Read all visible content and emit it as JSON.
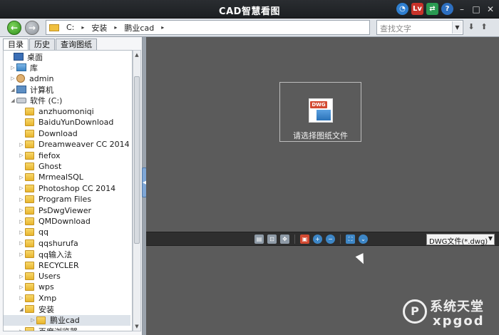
{
  "window": {
    "title": "CAD智慧看图"
  },
  "titlebar_icons": [
    {
      "name": "gauge-icon",
      "color": "#2f7fd0"
    },
    {
      "name": "pdf-icon",
      "text": "Lv",
      "color": "#c8332a"
    },
    {
      "name": "share-icon",
      "color": "#2a9a52"
    },
    {
      "name": "help-icon",
      "text": "?",
      "color": "#2d6fc0"
    }
  ],
  "window_controls": {
    "minimize": "–",
    "maximize": "□",
    "close": "✕"
  },
  "address": {
    "segments": [
      "C:",
      "安装",
      "鹏业cad"
    ],
    "separator": "▸",
    "search_placeholder": "查找文字"
  },
  "tabs": [
    {
      "label": "目录",
      "active": true
    },
    {
      "label": "历史",
      "active": false
    },
    {
      "label": "查询图纸",
      "active": false
    }
  ],
  "tree": [
    {
      "label": "桌面",
      "level": 0,
      "icon": "desktop",
      "expand": ""
    },
    {
      "label": "库",
      "level": 1,
      "icon": "library",
      "expand": "▷"
    },
    {
      "label": "admin",
      "level": 1,
      "icon": "user",
      "expand": "▷"
    },
    {
      "label": "计算机",
      "level": 1,
      "icon": "computer",
      "expand": "◢"
    },
    {
      "label": "软件 (C:)",
      "level": 2,
      "icon": "drive",
      "expand": "◢"
    },
    {
      "label": "anzhuomoniqi",
      "level": 3,
      "icon": "folder",
      "expand": ""
    },
    {
      "label": "BaiduYunDownload",
      "level": 3,
      "icon": "folder",
      "expand": ""
    },
    {
      "label": "Download",
      "level": 3,
      "icon": "folder",
      "expand": ""
    },
    {
      "label": "Dreamweaver CC 2014",
      "level": 3,
      "icon": "folder",
      "expand": "▷"
    },
    {
      "label": "fiefox",
      "level": 3,
      "icon": "folder",
      "expand": "▷"
    },
    {
      "label": "Ghost",
      "level": 3,
      "icon": "folder",
      "expand": ""
    },
    {
      "label": "MrmealSQL",
      "level": 3,
      "icon": "folder",
      "expand": "▷"
    },
    {
      "label": "Photoshop CC 2014",
      "level": 3,
      "icon": "folder",
      "expand": "▷"
    },
    {
      "label": "Program Files",
      "level": 3,
      "icon": "folder",
      "expand": "▷"
    },
    {
      "label": "PsDwgViewer",
      "level": 3,
      "icon": "folder",
      "expand": "▷"
    },
    {
      "label": "QMDownload",
      "level": 3,
      "icon": "folder",
      "expand": "▷"
    },
    {
      "label": "qq",
      "level": 3,
      "icon": "folder",
      "expand": "▷"
    },
    {
      "label": "qqshurufa",
      "level": 3,
      "icon": "folder",
      "expand": "▷"
    },
    {
      "label": "qq输入法",
      "level": 3,
      "icon": "folder",
      "expand": "▷"
    },
    {
      "label": "RECYCLER",
      "level": 3,
      "icon": "folder",
      "expand": ""
    },
    {
      "label": "Users",
      "level": 3,
      "icon": "folder",
      "expand": "▷"
    },
    {
      "label": "wps",
      "level": 3,
      "icon": "folder",
      "expand": "▷"
    },
    {
      "label": "Xmp",
      "level": 3,
      "icon": "folder",
      "expand": "▷"
    },
    {
      "label": "安装",
      "level": 3,
      "icon": "folder",
      "expand": "◢"
    },
    {
      "label": "鹏业cad",
      "level": 4,
      "icon": "folder",
      "expand": "▷",
      "selected": true
    },
    {
      "label": "百度浏览器",
      "level": 3,
      "icon": "folder",
      "expand": "▷"
    }
  ],
  "preview": {
    "badge": "DWG",
    "label": "请选择图纸文件"
  },
  "viewbar": {
    "icons": [
      "layers-icon",
      "zoom-window-icon",
      "pan-icon",
      "fit-icon",
      "zoom-in-icon",
      "zoom-out-icon",
      "fullscreen-icon",
      "more-icon"
    ],
    "filetype": "DWG文件(*.dwg)"
  },
  "watermark": {
    "cn": "系统天堂",
    "en": "xpgod"
  }
}
